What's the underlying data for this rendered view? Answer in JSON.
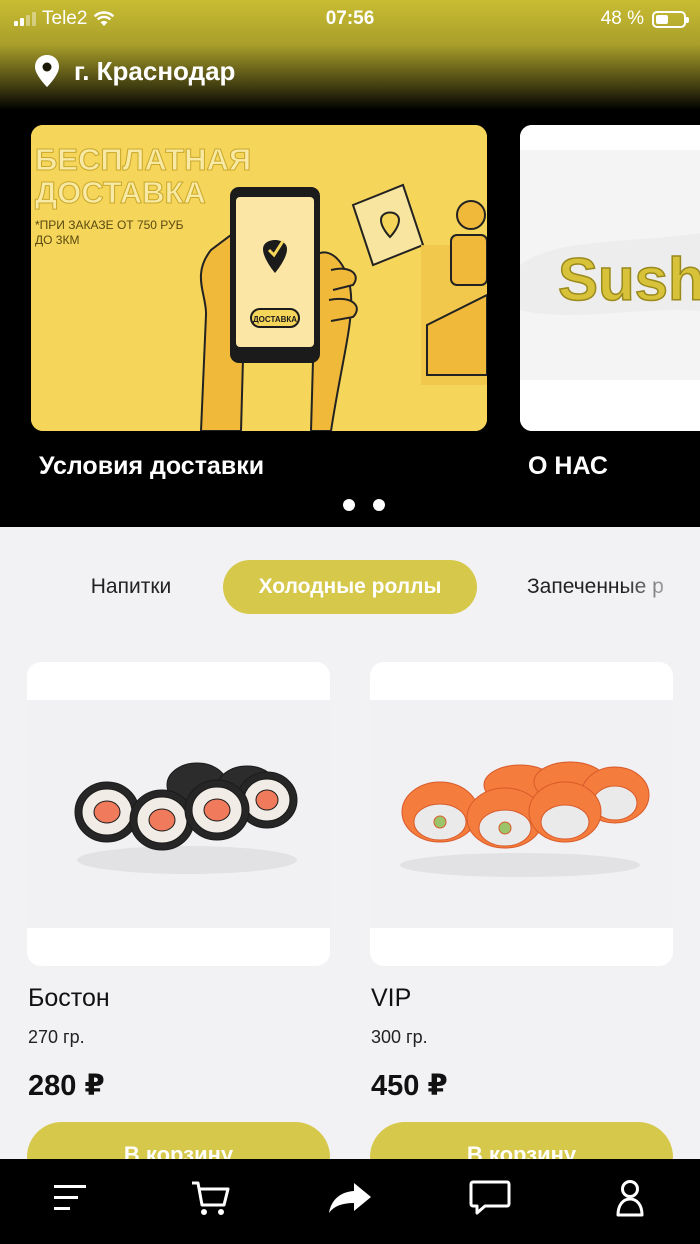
{
  "status_bar": {
    "carrier": "Tele2",
    "time": "07:56",
    "battery": "48 %",
    "battery_level": 0.48
  },
  "location": {
    "city": "г. Краснодар",
    "icon": "location-pin-icon"
  },
  "banners": [
    {
      "caption": "Условия доставки",
      "headline_line1": "БЕСПЛАТНАЯ",
      "headline_line2": "ДОСТАВКА",
      "note_line1": "*ПРИ ЗАКАЗЕ ОТ 750 РУБ",
      "note_line2": "ДО 3КМ",
      "phone_button": "ДОСТАВКА"
    },
    {
      "caption": "О НАС",
      "logo_text": "Sush"
    }
  ],
  "carousel": {
    "pages": 2,
    "active": 0
  },
  "categories": [
    {
      "label": "Напитки",
      "active": false
    },
    {
      "label": "Холодные роллы",
      "active": true
    },
    {
      "label": "Запеченные р",
      "active": false
    }
  ],
  "products": [
    {
      "name": "Бостон",
      "weight": "270 гр.",
      "price": "280 ₽",
      "button": "В корзину"
    },
    {
      "name": "VIP",
      "weight": "300 гр.",
      "price": "450 ₽",
      "button": "В корзину"
    }
  ],
  "tabbar": [
    {
      "icon": "menu-icon"
    },
    {
      "icon": "cart-icon"
    },
    {
      "icon": "share-icon"
    },
    {
      "icon": "chat-icon"
    },
    {
      "icon": "profile-icon"
    }
  ],
  "colors": {
    "accent": "#d6c84b",
    "header": "#000000",
    "background": "#f2f2f5",
    "banner_yellow": "#f5d55a"
  }
}
